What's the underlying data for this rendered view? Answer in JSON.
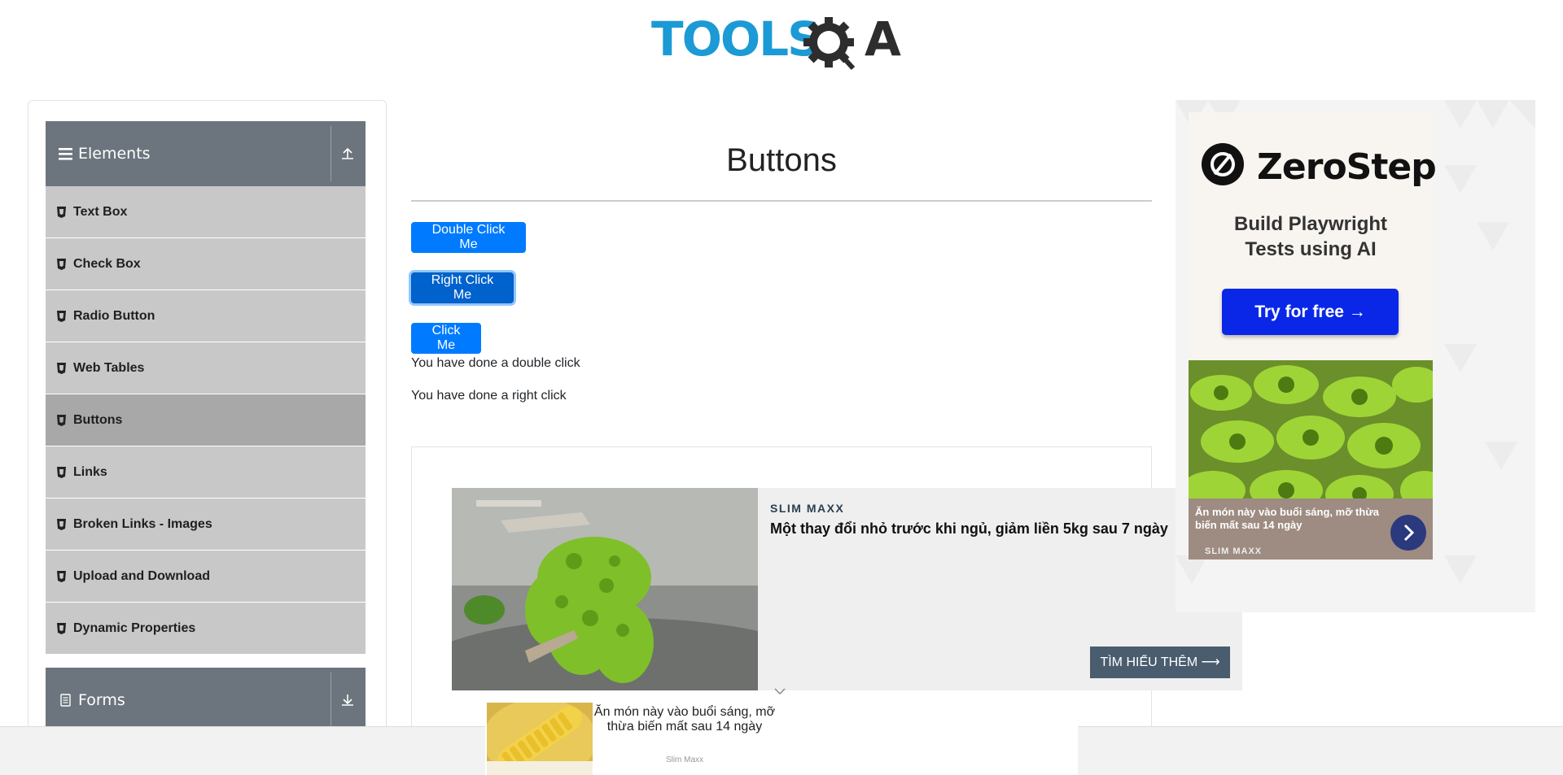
{
  "header": {
    "logo_alt": "TOOLSQA",
    "logo_text_tools": "TOOLS",
    "logo_text_qa": "QA"
  },
  "sidebar": {
    "group_elements": {
      "title": "Elements"
    },
    "items": [
      {
        "label": "Text Box",
        "active": false
      },
      {
        "label": "Check Box",
        "active": false
      },
      {
        "label": "Radio Button",
        "active": false
      },
      {
        "label": "Web Tables",
        "active": false
      },
      {
        "label": "Buttons",
        "active": true
      },
      {
        "label": "Links",
        "active": false
      },
      {
        "label": "Broken Links - Images",
        "active": false
      },
      {
        "label": "Upload and Download",
        "active": false
      },
      {
        "label": "Dynamic Properties",
        "active": false
      }
    ],
    "group_forms": {
      "title": "Forms"
    }
  },
  "main": {
    "title": "Buttons",
    "buttons": {
      "double_click": "Double Click Me",
      "right_click": "Right Click Me",
      "click": "Click Me"
    },
    "messages": {
      "double_click": "You have done a double click",
      "right_click": "You have done a right click"
    }
  },
  "inline_ad": {
    "brand": "SLIM MAXX",
    "headline": "Một thay đổi nhỏ trước khi ngủ, giảm liền 5kg sau 7 ngày",
    "cta": "TÌM HIỂU THÊM ⟶"
  },
  "right_ad": {
    "brand": "ZeroStep",
    "subtitle_line1": "Build Playwright",
    "subtitle_line2": "Tests using AI",
    "cta": "Try for free →",
    "caption": "Ăn món này vào buổi sáng, mỡ thừa biến mất sau 14 ngày",
    "source": "SLIM MAXX"
  },
  "bottom_ad": {
    "text": "Ăn món này vào buổi sáng, mỡ thừa biến mất sau 14 ngày",
    "source": "Slim Maxx"
  },
  "colors": {
    "primary": "#007bff",
    "sidebar_header": "#6c757d",
    "menu_item": "#c8c8c8",
    "menu_item_active": "#a8a8a8",
    "logo_blue": "#1b9ad6",
    "logo_dark": "#2d2d2d",
    "zerostep_blue": "#0a27e8"
  }
}
